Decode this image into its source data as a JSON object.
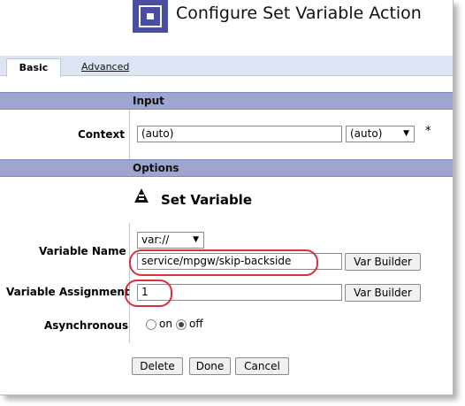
{
  "header": {
    "title": "Configure Set Variable Action",
    "icon": "set-variable-action-icon"
  },
  "tabs": [
    {
      "label": "Basic",
      "active": true
    },
    {
      "label": "Advanced",
      "active": false
    }
  ],
  "input_section": {
    "title": "Input",
    "context_label": "Context",
    "context_value": "(auto)",
    "context_select": "(auto)",
    "required_marker": "*"
  },
  "options_section": {
    "title": "Options",
    "set_variable_title": "Set Variable",
    "variable_name_label": "Variable Name",
    "scheme_select": "var://",
    "variable_name_value": "service/mpgw/skip-backside",
    "var_builder_label": "Var Builder",
    "assignment_label": "Variable Assignment",
    "assignment_value": "1",
    "async_label": "Asynchronous",
    "async_on_label": "on",
    "async_off_label": "off",
    "async_selected": "off"
  },
  "actions": {
    "delete": "Delete",
    "done": "Done",
    "cancel": "Cancel"
  },
  "colors": {
    "section_bar": "#9ea6cf",
    "tab_bar": "#dde4f3",
    "callout": "#d9313a",
    "header_icon": "#4a4ea0"
  }
}
